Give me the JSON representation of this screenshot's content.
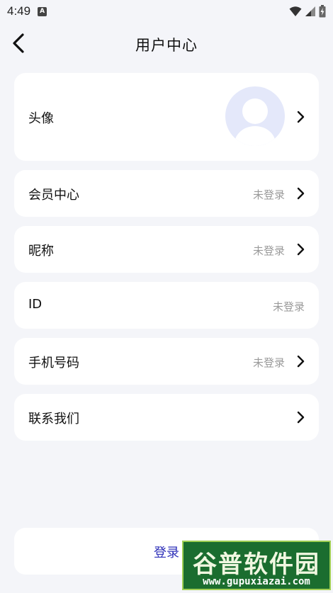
{
  "status_bar": {
    "time": "4:49",
    "notification_icon": "A"
  },
  "nav": {
    "title": "用户中心"
  },
  "avatar_row": {
    "label": "头像"
  },
  "rows": [
    {
      "label": "会员中心",
      "value": "未登录",
      "has_chevron": true
    },
    {
      "label": "昵称",
      "value": "未登录",
      "has_chevron": true
    },
    {
      "label": "ID",
      "value": "未登录",
      "has_chevron": false
    },
    {
      "label": "手机号码",
      "value": "未登录",
      "has_chevron": true
    },
    {
      "label": "联系我们",
      "value": "",
      "has_chevron": true
    }
  ],
  "login": {
    "label": "登录"
  },
  "watermark": {
    "title": "谷普软件园",
    "url": "www.gupuxiazai.com"
  },
  "colors": {
    "background": "#f4f5f9",
    "login_text": "#2d2fb8",
    "secondary_text": "#9a9a9a",
    "avatar_bg": "#e4e8fa"
  }
}
